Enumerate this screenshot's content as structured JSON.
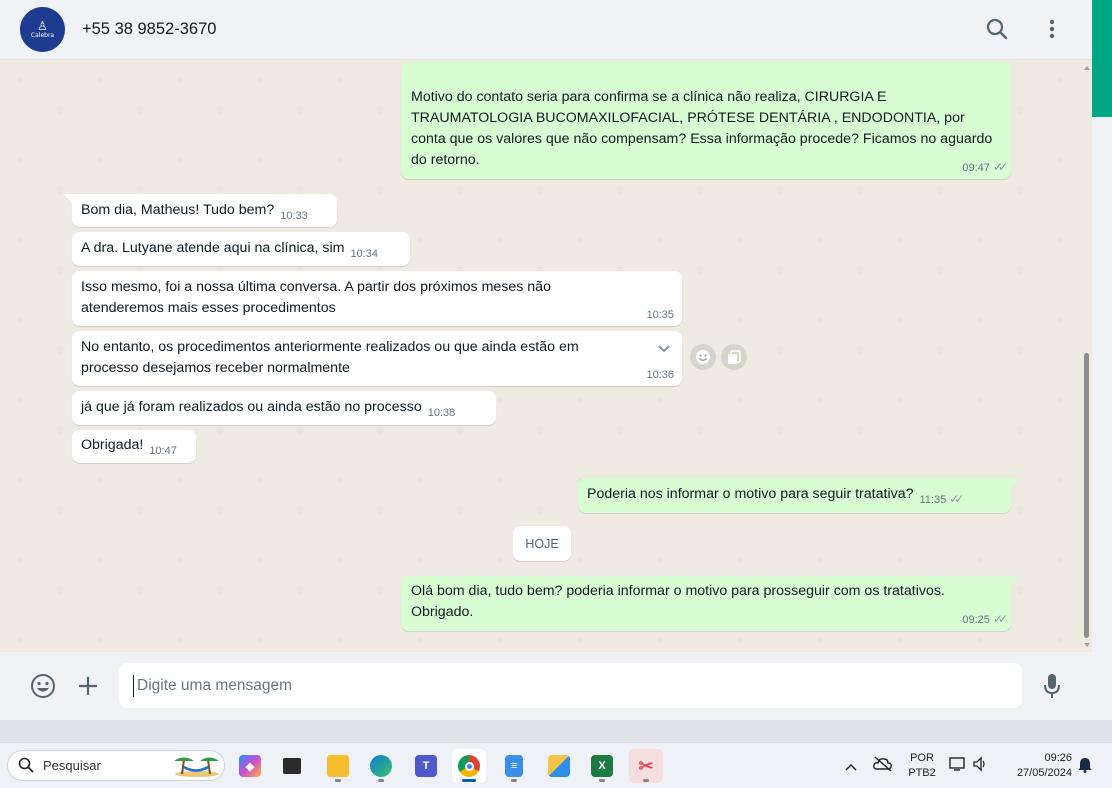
{
  "header": {
    "avatar_label": "Calebra",
    "contact_name": "+55 38 9852-3670"
  },
  "messages": [
    {
      "direction": "out",
      "text": "Motivo do contato seria para confirma se a clínica não realiza, CIRURGIA E TRAUMATOLOGIA BUCOMAXILOFACIAL, PRÓTESE DENTÁRIA , ENDODONTIA, por conta que os valores que não compensam? Essa informação procede? Ficamos no aguardo do retorno.",
      "time": "09:47",
      "read": true
    },
    {
      "direction": "in",
      "text": "Bom dia, Matheus! Tudo bem?",
      "time": "10:33"
    },
    {
      "direction": "in",
      "text": "A dra. Lutyane atende aqui na clínica, sim",
      "time": "10:34"
    },
    {
      "direction": "in",
      "text": "Isso mesmo, foi a nossa última conversa. A partir dos próximos meses não atenderemos mais esses procedimentos",
      "time": "10:35"
    },
    {
      "direction": "in",
      "text": "No entanto, os procedimentos anteriormente realizados ou que ainda estão em processo desejamos receber normalmente",
      "time": "10:36"
    },
    {
      "direction": "in",
      "text": "já que já foram realizados ou ainda estão no processo",
      "time": "10:38"
    },
    {
      "direction": "in",
      "text": "Obrigada!",
      "time": "10:47"
    },
    {
      "direction": "out",
      "text": "Poderia nos informar o motivo para seguir tratativa?",
      "time": "11:35",
      "read": true
    },
    {
      "direction": "out",
      "text": "Olá bom dia, tudo bem? poderia informar o motivo para prosseguir com os tratativos. Obrigado.",
      "time": "09:25",
      "read": true
    }
  ],
  "day_separator": "HOJE",
  "composer": {
    "placeholder": "Digite uma mensagem"
  },
  "taskbar": {
    "search_label": "Pesquisar",
    "language": "POR",
    "layout": "PTB2",
    "time": "09:26",
    "date": "27/05/2024",
    "apps": [
      "copilot",
      "task-view",
      "file-explorer",
      "edge",
      "teams",
      "chrome",
      "notepad",
      "onedrive-files",
      "excel",
      "snipping-tool"
    ],
    "active_app": "chrome"
  },
  "colors": {
    "outgoing_bubble": "#d9fdd3",
    "incoming_bubble": "#ffffff",
    "chat_bg": "#efeae2",
    "accent": "#00a884",
    "read_ticks": "#8696a0"
  }
}
